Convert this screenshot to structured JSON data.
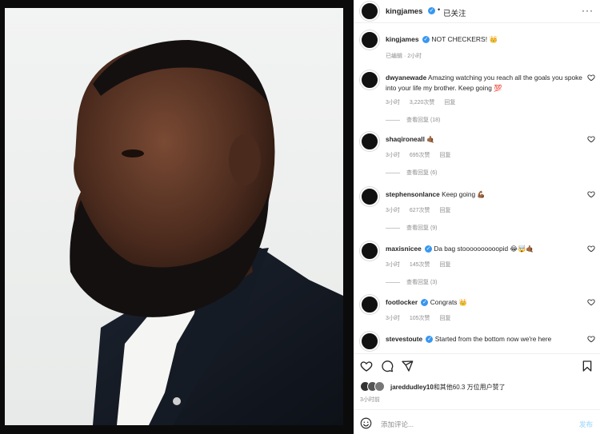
{
  "header": {
    "username": "kingjames",
    "separator": "•",
    "follow_state": "已关注",
    "more": "···"
  },
  "caption": {
    "username": "kingjames",
    "text": "NOT CHECKERS!",
    "emoji": "👑",
    "edited": "已编辑",
    "time": "2小时"
  },
  "comments": [
    {
      "username": "dwyanewade",
      "verified": false,
      "text": "Amazing watching you reach all the goals you spoke into your life my brother. Keep going 💯",
      "time": "3小时",
      "likes": "3,220次赞",
      "reply": "回复",
      "view_replies": "查看回复 (18)"
    },
    {
      "username": "shaqironeall",
      "verified": false,
      "text": "🤙🏾",
      "time": "3小时",
      "likes": "695次赞",
      "reply": "回复",
      "view_replies": "查看回复 (6)"
    },
    {
      "username": "stephensonlance",
      "verified": false,
      "text": "Keep going 💪🏾",
      "time": "3小时",
      "likes": "627次赞",
      "reply": "回复",
      "view_replies": "查看回复 (9)"
    },
    {
      "username": "maxisnicee",
      "verified": true,
      "text": "Da bag stoooooooooopid 😂🤯🤙🏾",
      "time": "3小时",
      "likes": "145次赞",
      "reply": "回复",
      "view_replies": "查看回复 (3)"
    },
    {
      "username": "footlocker",
      "verified": true,
      "text": "Congrats 👑",
      "time": "3小时",
      "likes": "105次赞",
      "reply": "回复",
      "view_replies": ""
    },
    {
      "username": "stevestoute",
      "verified": true,
      "text": "Started from the bottom now we're here",
      "time": "",
      "likes": "",
      "reply": "",
      "view_replies": ""
    }
  ],
  "likes_line": {
    "lead_user": "jareddudley10",
    "rest": "和其他60.3 万位用户赞了"
  },
  "post_time": "3小时前",
  "add_comment": {
    "placeholder": "添加评论...",
    "post_label": "发布"
  },
  "colors": {
    "verified": "#3897f0",
    "secondary_text": "#8e8e8e",
    "post_button_disabled": "#b2dffc"
  },
  "icons": {
    "like": "heart-icon",
    "comment": "comment-icon",
    "share": "share-icon",
    "save": "bookmark-icon",
    "emoji": "emoji-icon",
    "comment_like": "heart-icon",
    "more": "more-icon"
  }
}
